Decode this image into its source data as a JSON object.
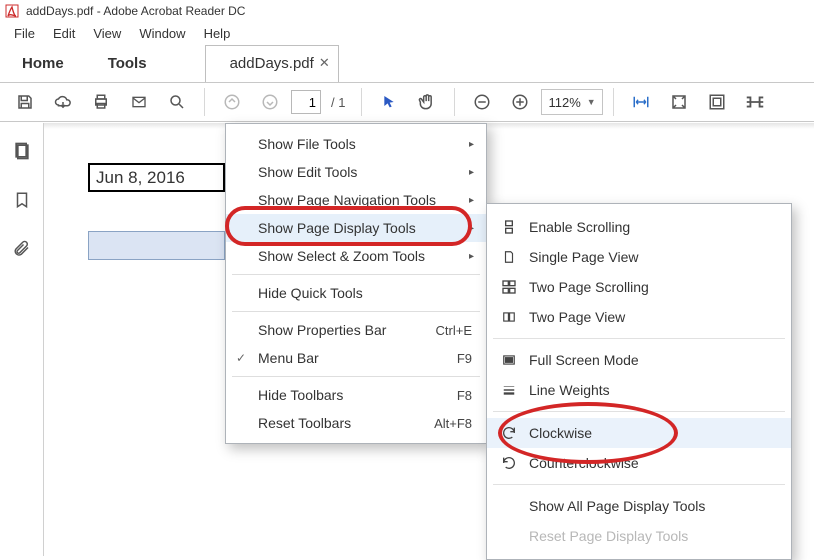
{
  "window": {
    "filename": "addDays.pdf",
    "app_title": " - Adobe Acrobat Reader DC"
  },
  "menubar": {
    "file": "File",
    "edit": "Edit",
    "view": "View",
    "window": "Window",
    "help": "Help"
  },
  "tabs": {
    "home": "Home",
    "tools": "Tools",
    "doc": "addDays.pdf"
  },
  "toolbar": {
    "page_current": "1",
    "page_total": "/ 1",
    "zoom_value": "112%"
  },
  "content": {
    "date_value": "Jun 8, 2016"
  },
  "context_menu": {
    "show_file": "Show File Tools",
    "show_edit": "Show Edit Tools",
    "show_nav": "Show Page Navigation Tools",
    "show_display": "Show Page Display Tools",
    "show_zoom": "Show Select & Zoom Tools",
    "hide_quick": "Hide Quick Tools",
    "show_prop": "Show Properties Bar",
    "show_prop_key": "Ctrl+E",
    "menu_bar": "Menu Bar",
    "menu_bar_key": "F9",
    "hide_toolbars": "Hide Toolbars",
    "hide_toolbars_key": "F8",
    "reset_toolbars": "Reset Toolbars",
    "reset_toolbars_key": "Alt+F8"
  },
  "submenu": {
    "enable_scroll": "Enable Scrolling",
    "single_page": "Single Page View",
    "two_scroll": "Two Page Scrolling",
    "two_page": "Two Page View",
    "full_screen": "Full Screen Mode",
    "line_weights": "Line Weights",
    "clockwise": "Clockwise",
    "counter": "Counterclockwise",
    "show_all": "Show All Page Display Tools",
    "reset": "Reset Page Display Tools"
  }
}
